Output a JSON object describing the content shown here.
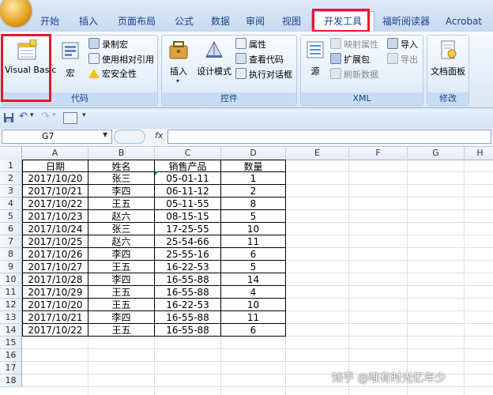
{
  "tabs": [
    "开始",
    "插入",
    "页面布局",
    "公式",
    "数据",
    "审阅",
    "视图",
    "开发工具",
    "福昕阅读器",
    "Acrobat"
  ],
  "active_tab_index": 7,
  "highlight_color": "#e6182b",
  "ribbon": {
    "code_group": {
      "label": "代码",
      "visual_basic": "Visual Basic",
      "macro": "宏",
      "record_macro": "录制宏",
      "relative_ref": "使用相对引用",
      "macro_security": "宏安全性"
    },
    "controls_group": {
      "label": "控件",
      "insert": "插入",
      "design_mode": "设计模式",
      "properties": "属性",
      "view_code": "查看代码",
      "run_dialog": "执行对话框"
    },
    "xml_group": {
      "label": "XML",
      "source": "源",
      "map_properties": "映射属性",
      "expansion_pack": "扩展包",
      "refresh_data": "刷新数据",
      "import": "导入",
      "export": "导出"
    },
    "modify_group": {
      "label": "修改",
      "document_panel": "文档面板"
    }
  },
  "formula_bar": {
    "name_box": "G7",
    "fx": "fx",
    "value": ""
  },
  "columns": [
    "A",
    "B",
    "C",
    "D",
    "E",
    "F",
    "G",
    "H"
  ],
  "rows": [
    "1",
    "2",
    "3",
    "4",
    "5",
    "6",
    "7",
    "8",
    "9",
    "10",
    "11",
    "12",
    "13",
    "14",
    "15",
    "16",
    "17",
    "18"
  ],
  "table": {
    "headers": [
      "日期",
      "姓名",
      "销售产品",
      "数量"
    ],
    "data": [
      [
        "2017/10/20",
        "张三",
        "05-01-11",
        "1"
      ],
      [
        "2017/10/21",
        "李四",
        "06-11-12",
        "2"
      ],
      [
        "2017/10/22",
        "王五",
        "05-11-55",
        "8"
      ],
      [
        "2017/10/23",
        "赵六",
        "08-15-15",
        "5"
      ],
      [
        "2017/10/24",
        "张三",
        "17-25-55",
        "10"
      ],
      [
        "2017/10/25",
        "赵六",
        "25-54-66",
        "11"
      ],
      [
        "2017/10/26",
        "李四",
        "25-55-16",
        "6"
      ],
      [
        "2017/10/27",
        "王五",
        "16-22-53",
        "5"
      ],
      [
        "2017/10/28",
        "李四",
        "16-55-88",
        "14"
      ],
      [
        "2017/10/29",
        "王五",
        "16-55-88",
        "4"
      ],
      [
        "2017/10/20",
        "王五",
        "16-22-53",
        "10"
      ],
      [
        "2017/10/21",
        "李四",
        "16-55-88",
        "11"
      ],
      [
        "2017/10/22",
        "王五",
        "16-55-88",
        "6"
      ]
    ]
  },
  "watermark": "知乎 @唯有时光忆年少"
}
